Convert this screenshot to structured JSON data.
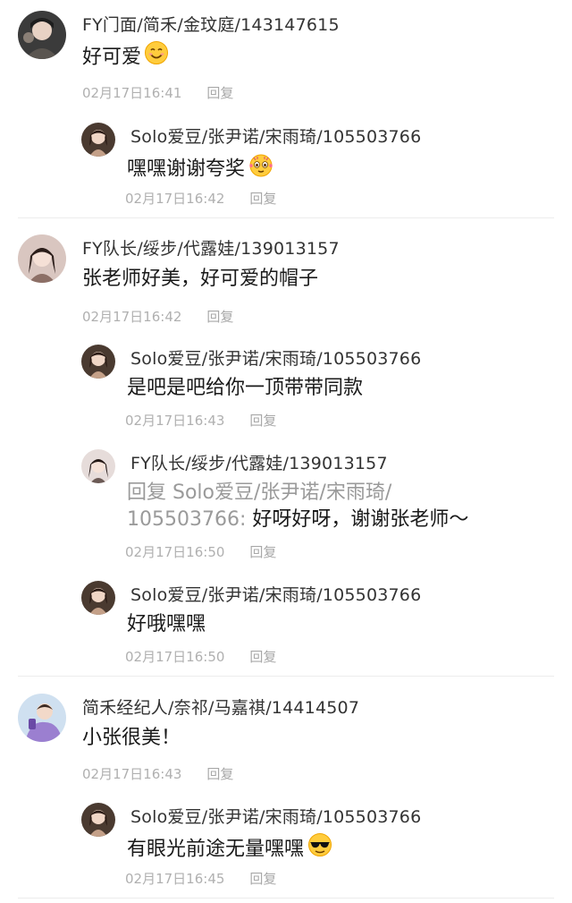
{
  "reply_label": "回复",
  "comments": [
    {
      "name": "FY门面/简禾/金玟庭/143147615",
      "text": "好可爱",
      "emoji": "smile-emoji",
      "time": "02月17日16:41",
      "replies": [
        {
          "name": "Solo爱豆/张尹诺/宋雨琦/105503766",
          "text": "嘿嘿谢谢夸奖",
          "emoji": "love-emoji",
          "time": "02月17日16:42"
        }
      ]
    },
    {
      "name": "FY队长/绥步/代露娃/139013157",
      "text": "张老师好美，好可爱的帽子",
      "time": "02月17日16:42",
      "replies": [
        {
          "name": "Solo爱豆/张尹诺/宋雨琦/105503766",
          "text": "是吧是吧给你一顶带带同款",
          "time": "02月17日16:43"
        },
        {
          "name": "FY队长/绥步/代露娃/139013157",
          "reply_prefix_line1": "回复 Solo爱豆/张尹诺/宋雨琦/",
          "reply_prefix_line2": "105503766:",
          "text": " 好呀好呀，谢谢张老师～",
          "time": "02月17日16:50"
        },
        {
          "name": "Solo爱豆/张尹诺/宋雨琦/105503766",
          "text": "好哦嘿嘿",
          "time": "02月17日16:50"
        }
      ]
    },
    {
      "name": "简禾经纪人/奈祁/马嘉祺/14414507",
      "text": "小张很美！",
      "time": "02月17日16:43",
      "replies": [
        {
          "name": "Solo爱豆/张尹诺/宋雨琦/105503766",
          "text": "有眼光前途无量嘿嘿",
          "emoji": "sunglasses-emoji",
          "time": "02月17日16:45"
        }
      ]
    }
  ]
}
